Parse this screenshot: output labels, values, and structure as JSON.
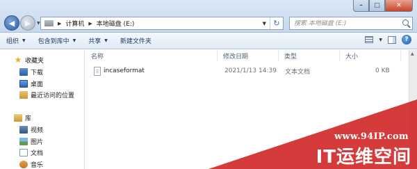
{
  "window": {
    "min_symbol": "–",
    "max_symbol": "□",
    "close_symbol": "✕"
  },
  "nav": {
    "back_symbol": "◀",
    "forward_symbol": "▶"
  },
  "address": {
    "crumbs": [
      "计算机",
      "本地磁盘 (E:)"
    ],
    "refresh_symbol": "↻"
  },
  "search": {
    "placeholder": "搜索 本地磁盘 (E:)"
  },
  "toolbar": {
    "organize": "组织",
    "include_in_library": "包含到库中",
    "share_with": "共享",
    "new_folder": "新建文件夹",
    "help": "?"
  },
  "sidebar": {
    "favorites": {
      "header": "收藏夹",
      "items": [
        "下载",
        "桌面",
        "最近访问的位置"
      ]
    },
    "libraries": {
      "header": "库",
      "items": [
        "视频",
        "图片",
        "文档",
        "音乐"
      ]
    }
  },
  "columns": [
    "名称",
    "修改日期",
    "类型",
    "大小"
  ],
  "files": [
    {
      "name": "incaseformat",
      "modified": "2021/1/13 14:39",
      "type": "文本文档",
      "size": "0 KB"
    }
  ],
  "watermark": {
    "url": "www.94IP.com",
    "name": "IT运维空间"
  },
  "colors": {
    "accent": "#2e5da0",
    "watermark": "#d22626"
  }
}
